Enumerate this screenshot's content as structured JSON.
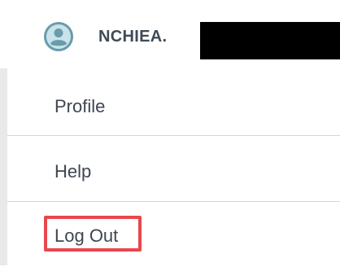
{
  "user": {
    "name": "NCHIEA.",
    "avatar_icon": "user-avatar-icon",
    "avatar_color": "#6a9bab",
    "avatar_bg": "#c8e3ea",
    "redaction_color": "#000000"
  },
  "menu": {
    "items": [
      {
        "label": "Profile"
      },
      {
        "label": "Help"
      },
      {
        "label": "Log Out"
      }
    ]
  },
  "highlight": {
    "target": "Log Out",
    "color": "#e8474c"
  }
}
